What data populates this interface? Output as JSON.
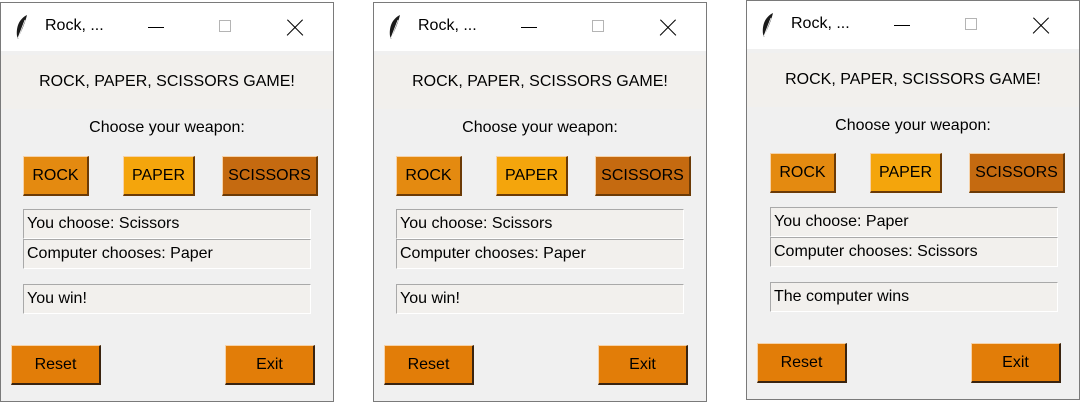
{
  "windows": [
    {
      "title": "Rock, ...",
      "heading": "ROCK, PAPER, SCISSORS GAME!",
      "prompt": "Choose your weapon:",
      "buttons": {
        "rock": "ROCK",
        "paper": "PAPER",
        "scissors": "SCISSORS"
      },
      "you_choose": "You choose: Scissors",
      "computer_chooses": "Computer chooses: Paper",
      "result": "You win!",
      "reset": "Reset",
      "exit": "Exit"
    },
    {
      "title": "Rock, ...",
      "heading": "ROCK, PAPER, SCISSORS GAME!",
      "prompt": "Choose your weapon:",
      "buttons": {
        "rock": "ROCK",
        "paper": "PAPER",
        "scissors": "SCISSORS"
      },
      "you_choose": "You choose: Scissors",
      "computer_chooses": "Computer chooses: Paper",
      "result": "You win!",
      "reset": "Reset",
      "exit": "Exit"
    },
    {
      "title": "Rock, ...",
      "heading": "ROCK, PAPER, SCISSORS GAME!",
      "prompt": "Choose your weapon:",
      "buttons": {
        "rock": "ROCK",
        "paper": "PAPER",
        "scissors": "SCISSORS"
      },
      "you_choose": "You choose: Paper",
      "computer_chooses": "Computer chooses: Scissors",
      "result": "The computer wins",
      "reset": "Reset",
      "exit": "Exit"
    }
  ],
  "colors": {
    "rock": "#e48a10",
    "paper": "#f4a50c",
    "scissors": "#c56a10",
    "action": "#e27d08",
    "window_bg": "#f0f0f0"
  },
  "icons": {
    "app": "feather-icon",
    "minimize": "minimize-icon",
    "maximize": "maximize-icon",
    "close": "close-icon"
  }
}
